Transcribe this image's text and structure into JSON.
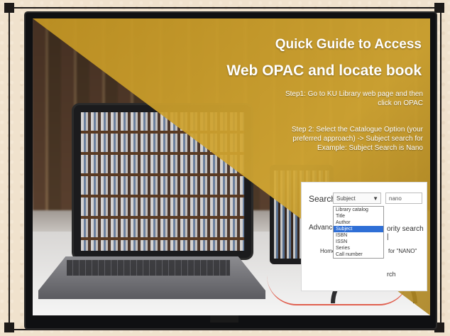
{
  "slide": {
    "title_line1": "Quick Guide to Access",
    "title_line2": "Web OPAC and locate book",
    "step1": "Step1: Go to KU Library web page and then click on OPAC",
    "step2": "Step 2: Select the Catalogue Option (your preferred approach) -> Subject search for Example: Subject Search is Nano"
  },
  "search_panel": {
    "search_label": "Search",
    "selected_option": "Subject",
    "query_value": "nano",
    "options": [
      "Library catalog",
      "Title",
      "Author",
      "Subject",
      "ISBN",
      "ISSN",
      "Series",
      "Call number"
    ],
    "selected_index": 3,
    "advanced_label": "Advance",
    "subject_search_text": "ority search |",
    "home_label": "Home",
    "results_text": "for \"NANO\"",
    "search_text": "rch"
  },
  "colors": {
    "gold_overlay": "#c8962a",
    "frame": "#1d1a18",
    "paper": "#f0e2cd"
  }
}
